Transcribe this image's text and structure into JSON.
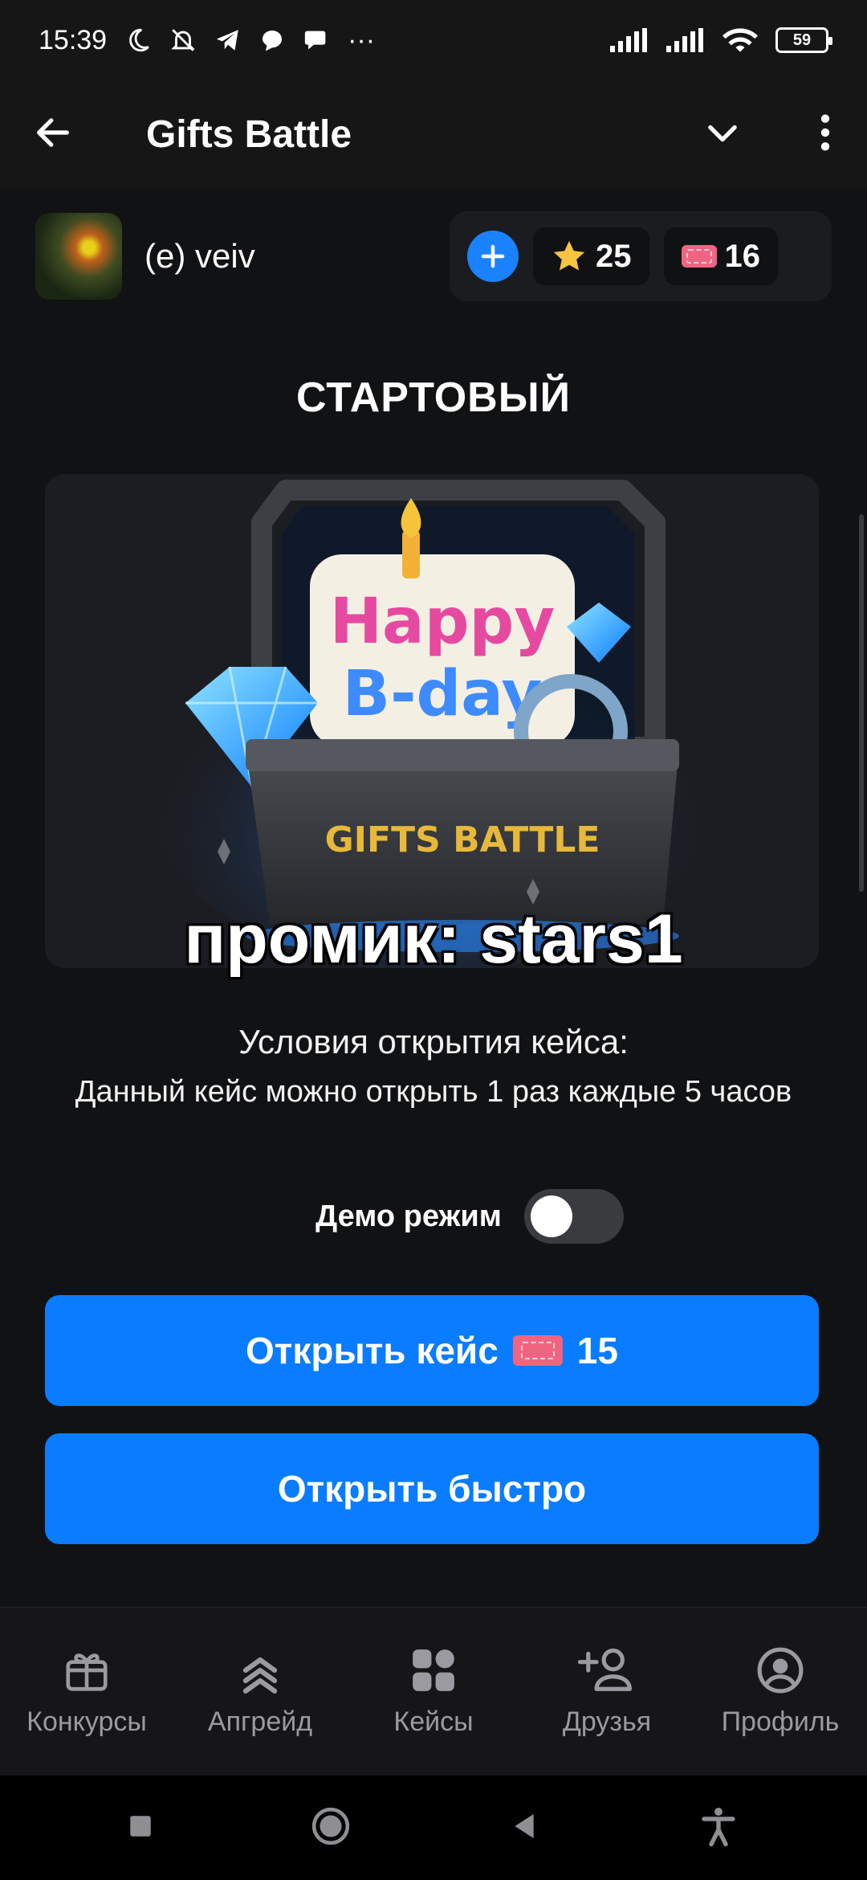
{
  "status_bar": {
    "time": "15:39",
    "more": "···",
    "battery": "59"
  },
  "app_bar": {
    "title": "Gifts Battle"
  },
  "user": {
    "name": "(e) veiv",
    "stars": "25",
    "tickets": "16"
  },
  "case": {
    "title": "СТАРТОВЫЙ",
    "banner_brand": "GIFTS BATTLE",
    "banner_line1": "Happy",
    "banner_line2": "B-day",
    "promo": "промик: stars1",
    "conditions_title": "Условия открытия кейса:",
    "conditions_text": "Данный кейс можно открыть 1 раз каждые 5 часов",
    "demo_label": "Демо режим",
    "demo_enabled": false,
    "open_label": "Открыть кейс",
    "open_price": "15",
    "open_fast_label": "Открыть быстро"
  },
  "tabs": [
    {
      "label": "Конкурсы",
      "icon": "gift-icon"
    },
    {
      "label": "Апгрейд",
      "icon": "upgrade-icon"
    },
    {
      "label": "Кейсы",
      "icon": "cases-icon"
    },
    {
      "label": "Друзья",
      "icon": "add-friend-icon"
    },
    {
      "label": "Профиль",
      "icon": "profile-icon"
    }
  ],
  "colors": {
    "accent": "#0a7cff",
    "background": "#111214",
    "ticket": "#f06482",
    "star": "#f5c542"
  }
}
